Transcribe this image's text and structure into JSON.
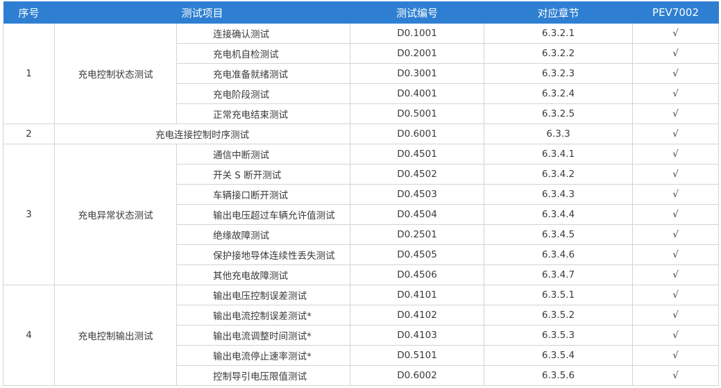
{
  "headers": [
    "序号",
    "测试项目",
    "测试编号",
    "对应章节",
    "PEV7002"
  ],
  "groups": [
    {
      "seq": "1",
      "name": "充电控制状态测试",
      "items": [
        {
          "item": "连接确认测试",
          "code": "D0.1001",
          "section": "6.3.2.1",
          "mark": "√"
        },
        {
          "item": "充电机自检测试",
          "code": "D0.2001",
          "section": "6.3.2.2",
          "mark": "√"
        },
        {
          "item": "充电准备就绪测试",
          "code": "D0.3001",
          "section": "6.3.2.3",
          "mark": "√"
        },
        {
          "item": "充电阶段测试",
          "code": "D0.4001",
          "section": "6.3.2.4",
          "mark": "√"
        },
        {
          "item": "正常充电结束测试",
          "code": "D0.5001",
          "section": "6.3.2.5",
          "mark": "√"
        }
      ]
    },
    {
      "seq": "2",
      "name": "充电连接控制时序测试",
      "single": true,
      "items": [
        {
          "code": "D0.6001",
          "section": "6.3.3",
          "mark": "√"
        }
      ]
    },
    {
      "seq": "3",
      "name": "充电异常状态测试",
      "items": [
        {
          "item": "通信中断测试",
          "code": "D0.4501",
          "section": "6.3.4.1",
          "mark": "√"
        },
        {
          "item": "开关 S 断开测试",
          "code": "D0.4502",
          "section": "6.3.4.2",
          "mark": "√"
        },
        {
          "item": "车辆接口断开测试",
          "code": "D0.4503",
          "section": "6.3.4.3",
          "mark": "√"
        },
        {
          "item": "输出电压超过车辆允许值测试",
          "code": "D0.4504",
          "section": "6.3.4.4",
          "mark": "√"
        },
        {
          "item": "绝缘故障测试",
          "code": "D0.2501",
          "section": "6.3.4.5",
          "mark": "√"
        },
        {
          "item": "保护接地导体连续性丢失测试",
          "code": "D0.4505",
          "section": "6.3.4.6",
          "mark": "√"
        },
        {
          "item": "其他充电故障测试",
          "code": "D0.4506",
          "section": "6.3.4.7",
          "mark": "√"
        }
      ]
    },
    {
      "seq": "4",
      "name": "充电控制输出测试",
      "items": [
        {
          "item": "输出电压控制误差测试",
          "code": "D0.4101",
          "section": "6.3.5.1",
          "mark": "√"
        },
        {
          "item": "输出电流控制误差测试*",
          "code": "D0.4102",
          "section": "6.3.5.2",
          "mark": "√"
        },
        {
          "item": "输出电流调整时间测试*",
          "code": "D0.4103",
          "section": "6.3.5.3",
          "mark": "√"
        },
        {
          "item": "输出电流停止速率测试*",
          "code": "D0.5101",
          "section": "6.3.5.4",
          "mark": "√"
        },
        {
          "item": "控制导引电压限值测试",
          "code": "D0.6002",
          "section": "6.3.5.6",
          "mark": "√"
        }
      ]
    }
  ]
}
